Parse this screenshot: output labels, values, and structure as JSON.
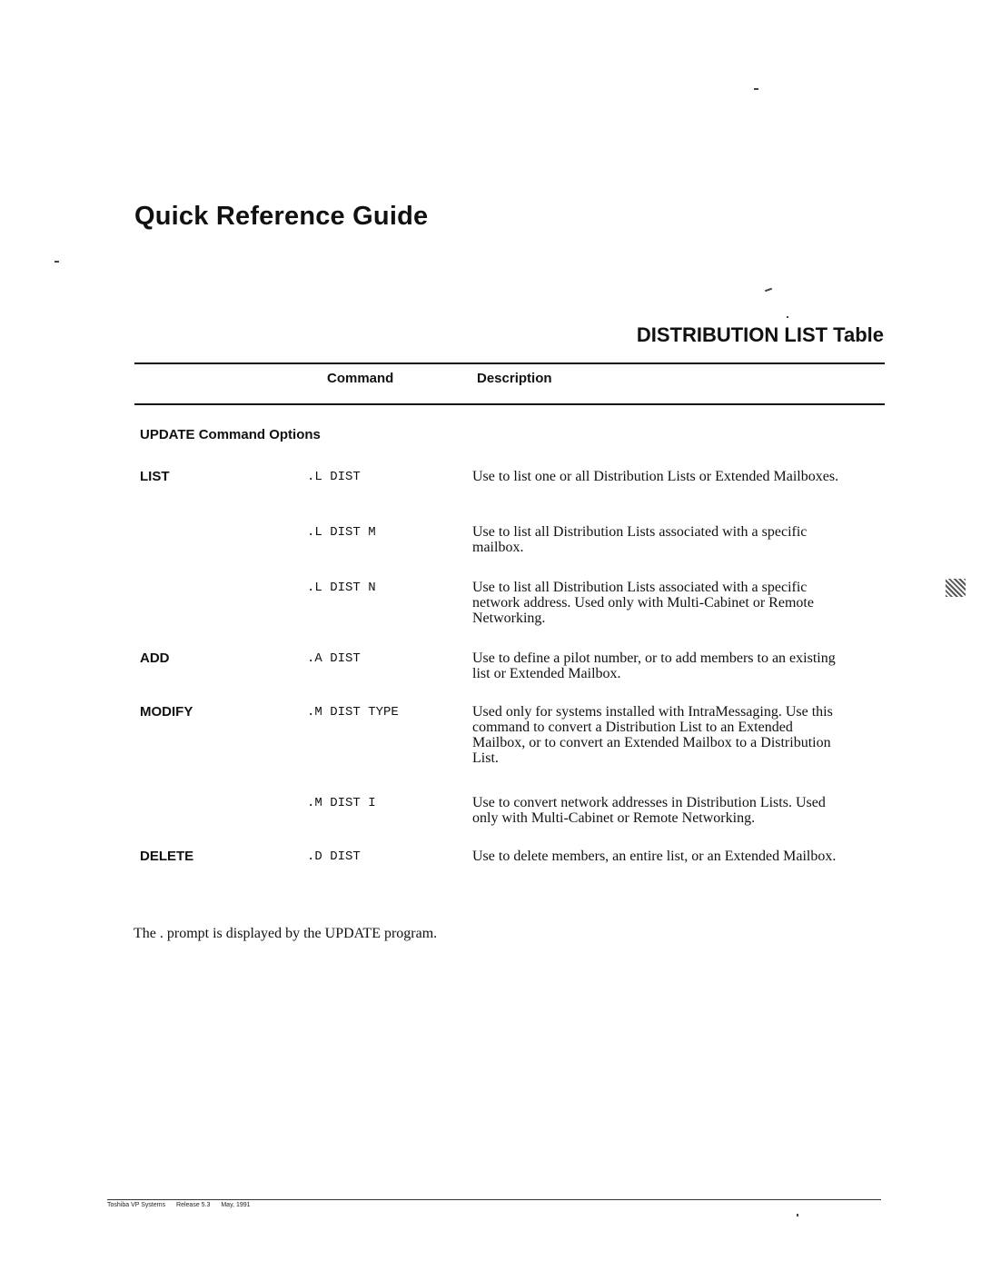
{
  "page_title": "Quick Reference Guide",
  "table_title": "DISTRIBUTION LIST Table",
  "table_headers": {
    "command": "Command",
    "description": "Description"
  },
  "section_heading": "UPDATE Command Options",
  "rows": [
    {
      "option": "LIST",
      "command": ".L DIST",
      "description": "Use to list one or all Distribution Lists or Extended Mailboxes."
    },
    {
      "option": "",
      "command": ".L DIST M",
      "description": "Use to list all Distribution Lists associated with a specific mailbox."
    },
    {
      "option": "",
      "command": ".L DIST N",
      "description": "Use to list all Distribution Lists associated with a specific network address. Used only with Multi-Cabinet or Remote Networking."
    },
    {
      "option": "ADD",
      "command": ".A DIST",
      "description": "Use to define a pilot number, or to add members to an existing list or Extended Mailbox."
    },
    {
      "option": "MODIFY",
      "command": ".M DIST TYPE",
      "description": "Used only for systems installed with IntraMessaging. Use this command to convert a Distribution List to an Extended Mailbox, or to convert an Extended Mailbox to a Distribution List."
    },
    {
      "option": "",
      "command": ".M DIST I",
      "description": "Use to convert network addresses in Distribution Lists. Used only with Multi-Cabinet or Remote Networking."
    },
    {
      "option": "DELETE",
      "command": ".D DIST",
      "description": "Use to delete members, an entire list, or an Extended Mailbox."
    }
  ],
  "footnote": "The . prompt is displayed by the UPDATE program.",
  "footer": {
    "company": "Toshiba VP Systems",
    "release": "Release 5.3",
    "date": "May, 1991"
  }
}
